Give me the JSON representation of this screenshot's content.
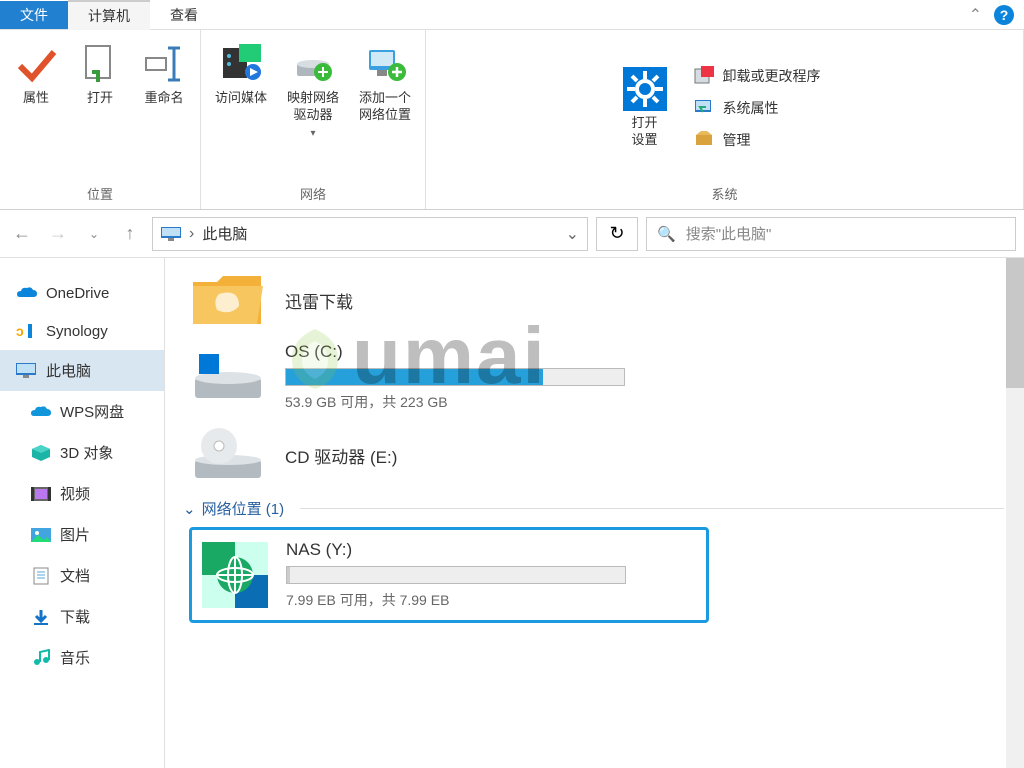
{
  "tabs": {
    "file": "文件",
    "computer": "计算机",
    "view": "查看"
  },
  "ribbon": {
    "group_location": {
      "name": "位置",
      "properties": "属性",
      "open": "打开",
      "rename": "重命名"
    },
    "group_network": {
      "name": "网络",
      "access_media": "访问媒体",
      "map_drive": "映射网络\n驱动器",
      "add_location": "添加一个\n网络位置"
    },
    "group_system": {
      "name": "系统",
      "open_settings": "打开\n设置",
      "uninstall": "卸载或更改程序",
      "sys_props": "系统属性",
      "manage": "管理"
    }
  },
  "address": {
    "crumb_sep": "›",
    "location": "此电脑"
  },
  "search": {
    "placeholder": "搜索\"此电脑\""
  },
  "sidebar": {
    "onedrive": "OneDrive",
    "synology": "Synology",
    "this_pc": "此电脑",
    "wps": "WPS网盘",
    "objects3d": "3D 对象",
    "videos": "视频",
    "pictures": "图片",
    "documents": "文档",
    "downloads": "下载",
    "music": "音乐"
  },
  "content": {
    "xunlei": "迅雷下载",
    "os_c": {
      "name": "OS (C:)",
      "text": "53.9 GB 可用，共 223 GB",
      "fill_pct": 76
    },
    "cd_e": {
      "name": "CD 驱动器 (E:)"
    },
    "net_section": "网络位置 (1)",
    "nas": {
      "name": "NAS (Y:)",
      "text": "7.99 EB 可用，共 7.99 EB",
      "fill_pct": 1
    }
  },
  "watermark": "umai"
}
